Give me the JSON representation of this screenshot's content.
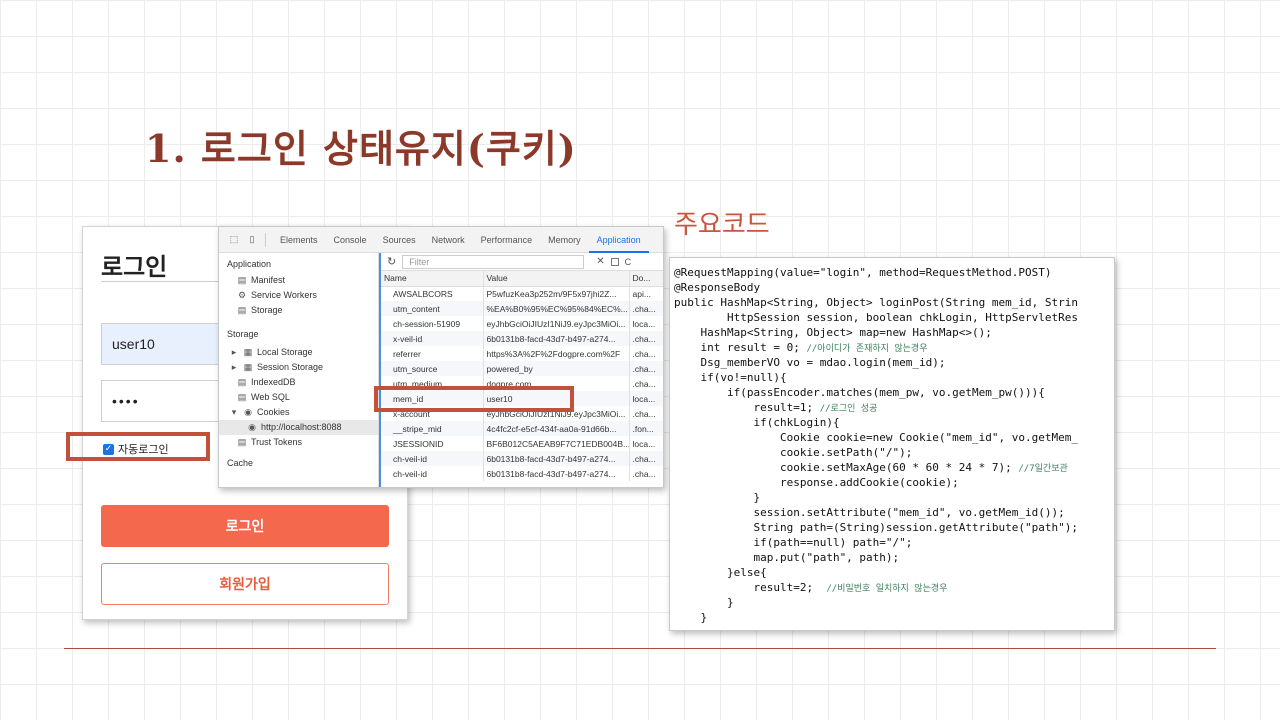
{
  "slide": {
    "title": "1. 로그인 상태유지(쿠키)",
    "code_heading": "주요코드"
  },
  "login": {
    "heading": "로그인",
    "username_value": "user10",
    "password_value": "••••",
    "autologin_label": "자동로그인",
    "autologin_checked": true,
    "login_button": "로그인",
    "join_button": "회원가입",
    "accent_color": "#f4694d"
  },
  "devtools": {
    "tabs": [
      "Elements",
      "Console",
      "Sources",
      "Network",
      "Performance",
      "Memory",
      "Application"
    ],
    "active_tab": "Application",
    "sidebar": {
      "application_header": "Application",
      "application_items": [
        "Manifest",
        "Service Workers",
        "Storage"
      ],
      "storage_header": "Storage",
      "storage_items": [
        "Local Storage",
        "Session Storage",
        "IndexedDB",
        "Web SQL",
        "Cookies"
      ],
      "cookie_origin": "http://localhost:8088",
      "trust_tokens": "Trust Tokens",
      "cache_header": "Cache"
    },
    "filter_placeholder": "Filter",
    "columns": [
      "Name",
      "Value",
      "Do..."
    ],
    "rows": [
      {
        "name": "AWSALBCORS",
        "value": "P5wfuzKea3p252m/9F5x97jhi2Z...",
        "domain": "api..."
      },
      {
        "name": "utm_content",
        "value": "%EA%B0%95%EC%95%84%EC%...",
        "domain": ".cha..."
      },
      {
        "name": "ch-session-51909",
        "value": "eyJhbGciOiJIUzI1NiJ9.eyJpc3MiOi...",
        "domain": "loca..."
      },
      {
        "name": "x-veil-id",
        "value": "6b0131b8-facd-43d7-b497-a274...",
        "domain": ".cha..."
      },
      {
        "name": "referrer",
        "value": "https%3A%2F%2Fdogpre.com%2F",
        "domain": ".cha..."
      },
      {
        "name": "utm_source",
        "value": "powered_by",
        "domain": ".cha..."
      },
      {
        "name": "utm_medium",
        "value": "dogpre.com",
        "domain": ".cha..."
      },
      {
        "name": "mem_id",
        "value": "user10",
        "domain": "loca..."
      },
      {
        "name": "x-account",
        "value": "eyJhbGciOiJIUzI1NiJ9.eyJpc3MiOi...",
        "domain": ".cha..."
      },
      {
        "name": "__stripe_mid",
        "value": "4c4fc2cf-e5cf-434f-aa0a-91d66b...",
        "domain": ".fon..."
      },
      {
        "name": "JSESSIONID",
        "value": "BF6B012C5AEAB9F7C71EDB004B...",
        "domain": "loca..."
      },
      {
        "name": "ch-veil-id",
        "value": "6b0131b8-facd-43d7-b497-a274...",
        "domain": ".cha..."
      },
      {
        "name": "ch-veil-id",
        "value": "6b0131b8-facd-43d7-b497-a274...",
        "domain": ".cha..."
      }
    ]
  },
  "code": {
    "lines": [
      {
        "text": "@RequestMapping(value=\"login\", method=RequestMethod.POST)",
        "comment": ""
      },
      {
        "text": "@ResponseBody",
        "comment": ""
      },
      {
        "text": "public HashMap<String, Object> loginPost(String mem_id, Strin",
        "comment": ""
      },
      {
        "text": "        HttpSession session, boolean chkLogin, HttpServletRes",
        "comment": ""
      },
      {
        "text": "    HashMap<String, Object> map=new HashMap<>();",
        "comment": ""
      },
      {
        "text": "    int result = 0; ",
        "comment": "//아이디가 존재하지 않는경우"
      },
      {
        "text": "    Dsg_memberVO vo = mdao.login(mem_id);",
        "comment": ""
      },
      {
        "text": "    if(vo!=null){",
        "comment": ""
      },
      {
        "text": "        if(passEncoder.matches(mem_pw, vo.getMem_pw())){",
        "comment": ""
      },
      {
        "text": "            result=1; ",
        "comment": "//로그인 성공"
      },
      {
        "text": "            if(chkLogin){",
        "comment": ""
      },
      {
        "text": "                Cookie cookie=new Cookie(\"mem_id\", vo.getMem_",
        "comment": ""
      },
      {
        "text": "                cookie.setPath(\"/\");",
        "comment": ""
      },
      {
        "text": "                cookie.setMaxAge(60 * 60 * 24 * 7); ",
        "comment": "//7일간보관"
      },
      {
        "text": "                response.addCookie(cookie);",
        "comment": ""
      },
      {
        "text": "            }",
        "comment": ""
      },
      {
        "text": "            session.setAttribute(\"mem_id\", vo.getMem_id());",
        "comment": ""
      },
      {
        "text": "            String path=(String)session.getAttribute(\"path\");",
        "comment": ""
      },
      {
        "text": "            if(path==null) path=\"/\";",
        "comment": ""
      },
      {
        "text": "            map.put(\"path\", path);",
        "comment": ""
      },
      {
        "text": "        }else{",
        "comment": ""
      },
      {
        "text": "            result=2;  ",
        "comment": "//비밀번호 일치하지 않는경우"
      },
      {
        "text": "        }",
        "comment": ""
      },
      {
        "text": "    }",
        "comment": ""
      }
    ]
  },
  "colors": {
    "title": "#8b3a2a",
    "highlight_box": "#c2513c",
    "devtools_active": "#1a73e8"
  }
}
